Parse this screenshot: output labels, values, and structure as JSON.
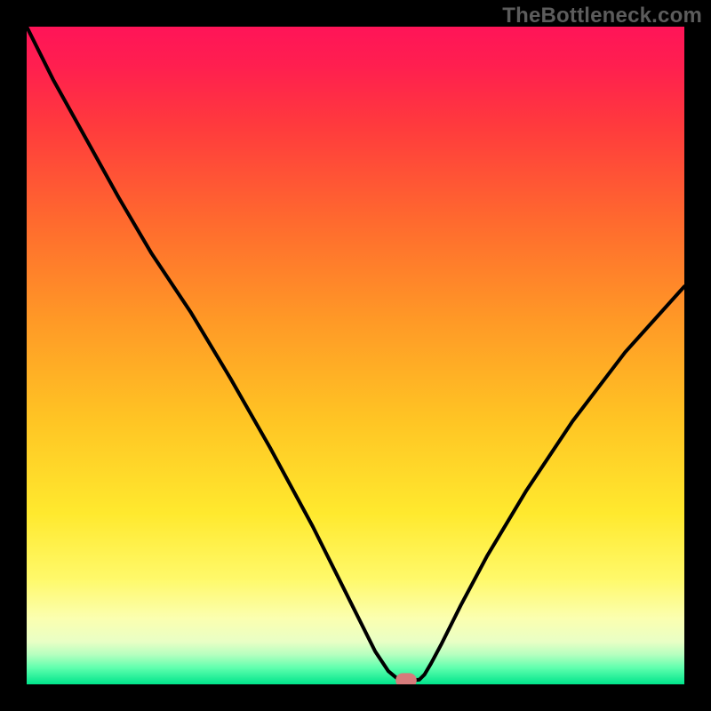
{
  "watermark": "TheBottleneck.com",
  "chart_data": {
    "type": "line",
    "title": "",
    "xlabel": "",
    "ylabel": "",
    "xlim": [
      0,
      100
    ],
    "ylim": [
      0,
      100
    ],
    "grid": false,
    "legend": false,
    "gradient_stops": [
      {
        "offset": 0.0,
        "color": "#ff1458"
      },
      {
        "offset": 0.06,
        "color": "#ff1f4f"
      },
      {
        "offset": 0.15,
        "color": "#ff3a3d"
      },
      {
        "offset": 0.3,
        "color": "#ff6b2e"
      },
      {
        "offset": 0.45,
        "color": "#ff9a26"
      },
      {
        "offset": 0.6,
        "color": "#ffc524"
      },
      {
        "offset": 0.74,
        "color": "#ffe92e"
      },
      {
        "offset": 0.84,
        "color": "#fff96a"
      },
      {
        "offset": 0.9,
        "color": "#fbffb0"
      },
      {
        "offset": 0.935,
        "color": "#e9ffc5"
      },
      {
        "offset": 0.955,
        "color": "#b5ffbf"
      },
      {
        "offset": 0.975,
        "color": "#5fffae"
      },
      {
        "offset": 1.0,
        "color": "#00e48b"
      }
    ],
    "series": [
      {
        "name": "bottleneck-curve",
        "color": "#000000",
        "x": [
          0,
          4,
          9,
          14,
          19,
          25,
          31,
          37,
          43.5,
          49.5,
          53,
          55,
          56.2,
          57,
          58.3,
          59.7,
          60.5,
          61.5,
          63,
          66,
          70,
          76,
          83,
          91,
          100
        ],
        "y": [
          100,
          92,
          83,
          74,
          65.5,
          56.5,
          46.5,
          36,
          24,
          12,
          5,
          2,
          1,
          0.6,
          0.6,
          0.7,
          1.5,
          3.2,
          6,
          12,
          19.5,
          29.5,
          40,
          50.5,
          60.5
        ]
      }
    ],
    "marker": {
      "x": 57.7,
      "y": 0.6,
      "rx": 1.6,
      "ry": 1.1,
      "fill": "#d67b7b"
    }
  }
}
